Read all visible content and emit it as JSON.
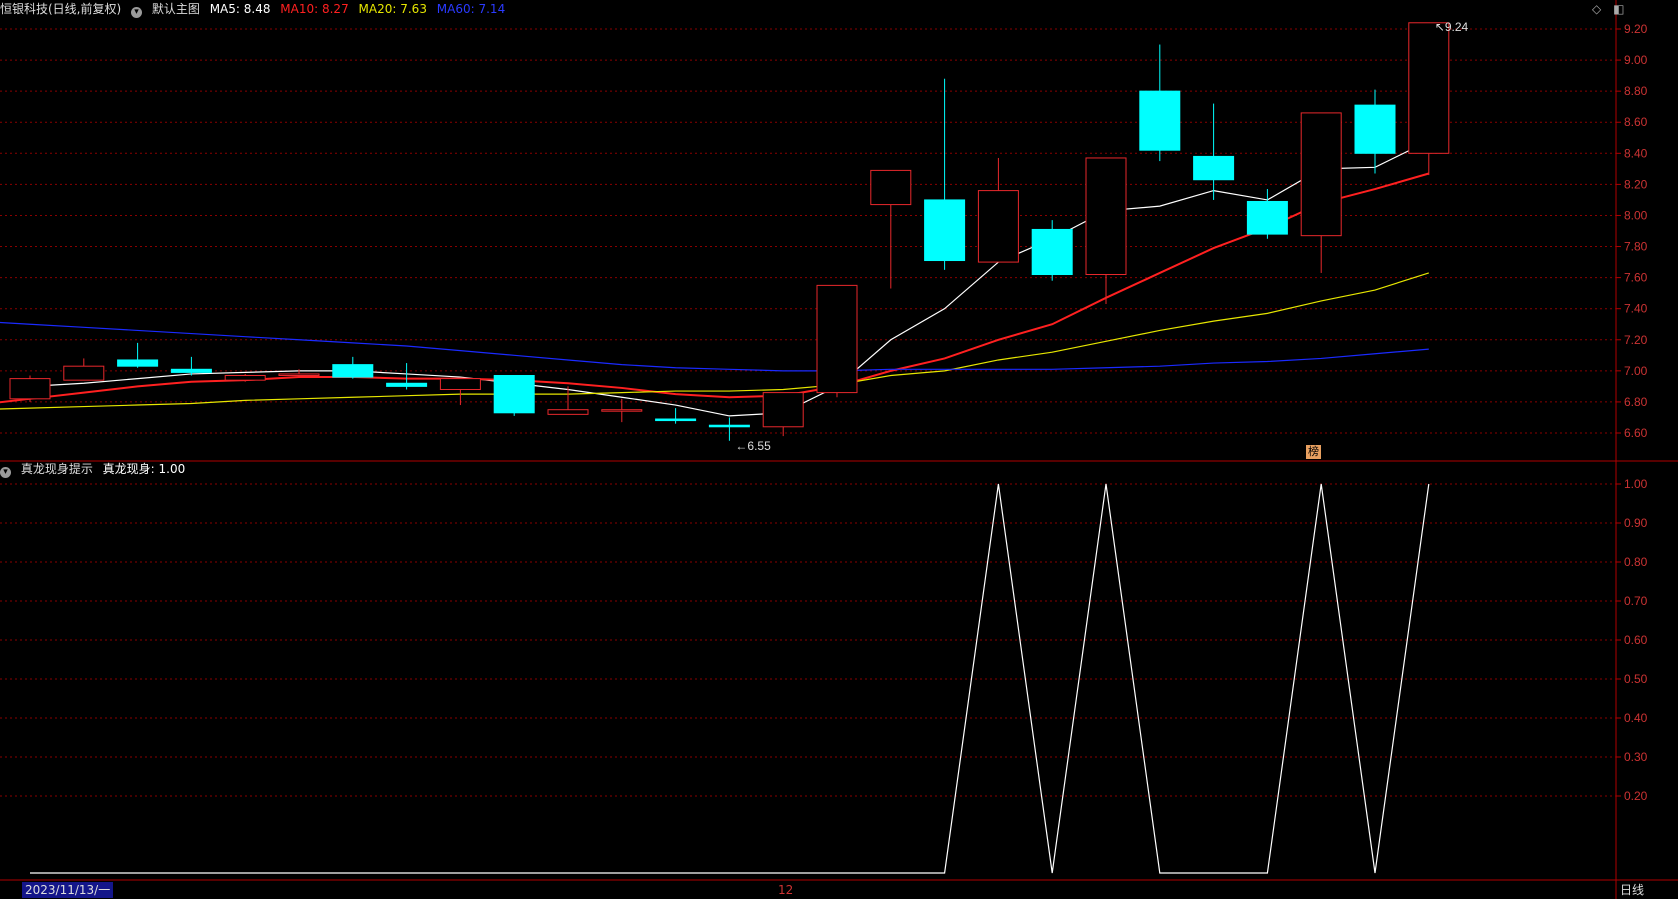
{
  "header": {
    "stock": "恒银科技(日线,前复权)",
    "template": "默认主图",
    "ma5_label": "MA5: 8.48",
    "ma10_label": "MA10: 8.27",
    "ma20_label": "MA20: 7.63",
    "ma60_label": "MA60: 7.14"
  },
  "indicator_header": {
    "name": "真龙现身提示",
    "value_label": "真龙现身: 1.00"
  },
  "footer": {
    "date": "2023/11/13/一",
    "month_marker": "12",
    "period": "日线"
  },
  "badge": "榜",
  "annotations": {
    "high": "9.24",
    "low": "6.55"
  },
  "colors": {
    "up": "#e8282c",
    "down": "#00ffff",
    "ma5": "#ffffff",
    "ma10": "#ff2020",
    "ma20": "#e6e600",
    "ma60": "#1a2aff",
    "grid": "#8a0000",
    "indicator": "#ffffff"
  },
  "chart_data": [
    {
      "type": "candlestick",
      "title": "恒银科技(日线,前复权)",
      "ylim": [
        6.5,
        9.3
      ],
      "yticks": [
        "9.20",
        "9.00",
        "8.80",
        "8.60",
        "8.40",
        "8.20",
        "8.00",
        "7.80",
        "7.60",
        "7.40",
        "7.20",
        "7.00",
        "6.80",
        "6.60"
      ],
      "candles": [
        {
          "o": 6.82,
          "c": 6.95,
          "h": 6.97,
          "l": 6.8
        },
        {
          "o": 6.94,
          "c": 7.03,
          "h": 7.08,
          "l": 6.94
        },
        {
          "o": 7.07,
          "c": 7.03,
          "h": 7.18,
          "l": 7.02
        },
        {
          "o": 7.01,
          "c": 6.99,
          "h": 7.09,
          "l": 6.97
        },
        {
          "o": 6.94,
          "c": 6.97,
          "h": 6.98,
          "l": 6.93
        },
        {
          "o": 6.97,
          "c": 6.98,
          "h": 7.01,
          "l": 6.96
        },
        {
          "o": 7.04,
          "c": 6.96,
          "h": 7.09,
          "l": 6.95
        },
        {
          "o": 6.92,
          "c": 6.9,
          "h": 7.05,
          "l": 6.88
        },
        {
          "o": 6.88,
          "c": 6.95,
          "h": 6.95,
          "l": 6.78
        },
        {
          "o": 6.97,
          "c": 6.73,
          "h": 6.97,
          "l": 6.71
        },
        {
          "o": 6.72,
          "c": 6.75,
          "h": 6.9,
          "l": 6.72
        },
        {
          "o": 6.75,
          "c": 6.75,
          "h": 6.82,
          "l": 6.67
        },
        {
          "o": 6.69,
          "c": 6.68,
          "h": 6.76,
          "l": 6.66
        },
        {
          "o": 6.65,
          "c": 6.64,
          "h": 6.7,
          "l": 6.55
        },
        {
          "o": 6.64,
          "c": 6.86,
          "h": 6.86,
          "l": 6.58
        },
        {
          "o": 6.86,
          "c": 7.55,
          "h": 7.55,
          "l": 6.83
        },
        {
          "o": 8.07,
          "c": 8.29,
          "h": 8.29,
          "l": 7.53
        },
        {
          "o": 8.1,
          "c": 7.71,
          "h": 8.88,
          "l": 7.65
        },
        {
          "o": 7.7,
          "c": 8.16,
          "h": 8.37,
          "l": 7.7
        },
        {
          "o": 7.91,
          "c": 7.62,
          "h": 7.97,
          "l": 7.58
        },
        {
          "o": 7.62,
          "c": 8.37,
          "h": 8.37,
          "l": 7.43
        },
        {
          "o": 8.8,
          "c": 8.42,
          "h": 9.1,
          "l": 8.35
        },
        {
          "o": 8.38,
          "c": 8.23,
          "h": 8.72,
          "l": 8.1
        },
        {
          "o": 8.09,
          "c": 7.88,
          "h": 8.17,
          "l": 7.85
        },
        {
          "o": 7.87,
          "c": 8.66,
          "h": 8.66,
          "l": 7.63
        },
        {
          "o": 8.71,
          "c": 8.4,
          "h": 8.81,
          "l": 8.27
        },
        {
          "o": 8.4,
          "c": 9.24,
          "h": 9.24,
          "l": 8.26
        }
      ],
      "series": [
        {
          "name": "MA5",
          "values": [
            6.9,
            6.92,
            6.95,
            6.98,
            6.99,
            7.0,
            7.0,
            6.98,
            6.96,
            6.92,
            6.88,
            6.83,
            6.78,
            6.71,
            6.73,
            6.9,
            7.2,
            7.4,
            7.7,
            7.85,
            8.03,
            8.06,
            8.16,
            8.1,
            8.3,
            8.31,
            8.48
          ]
        },
        {
          "name": "MA10",
          "values": [
            6.78,
            6.82,
            6.86,
            6.9,
            6.93,
            6.94,
            6.96,
            6.96,
            6.95,
            6.95,
            6.94,
            6.92,
            6.89,
            6.85,
            6.83,
            6.84,
            6.9,
            7.0,
            7.08,
            7.2,
            7.3,
            7.47,
            7.63,
            7.79,
            7.92,
            8.08,
            8.17,
            8.27
          ]
        },
        {
          "name": "MA20",
          "values": [
            6.75,
            6.76,
            6.77,
            6.78,
            6.79,
            6.81,
            6.82,
            6.83,
            6.84,
            6.85,
            6.85,
            6.85,
            6.86,
            6.87,
            6.87,
            6.88,
            6.91,
            6.97,
            7.0,
            7.07,
            7.12,
            7.19,
            7.26,
            7.32,
            7.37,
            7.45,
            7.52,
            7.63
          ]
        },
        {
          "name": "MA60",
          "values": [
            7.32,
            7.3,
            7.28,
            7.26,
            7.24,
            7.22,
            7.2,
            7.18,
            7.16,
            7.13,
            7.1,
            7.07,
            7.04,
            7.02,
            7.01,
            7.0,
            7.0,
            7.01,
            7.01,
            7.01,
            7.01,
            7.02,
            7.03,
            7.05,
            7.06,
            7.08,
            7.11,
            7.14
          ]
        }
      ]
    },
    {
      "type": "line",
      "title": "真龙现身提示",
      "ylim": [
        0,
        1.05
      ],
      "yticks": [
        "1.00",
        "0.90",
        "0.80",
        "0.70",
        "0.60",
        "0.50",
        "0.40",
        "0.30",
        "0.20"
      ],
      "series": [
        {
          "name": "真龙现身",
          "values": [
            0,
            0,
            0,
            0,
            0,
            0,
            0,
            0,
            0,
            0,
            0,
            0,
            0,
            0,
            0,
            0,
            0,
            0,
            1,
            0,
            1,
            0,
            0,
            0,
            1,
            0,
            1
          ]
        }
      ]
    }
  ]
}
